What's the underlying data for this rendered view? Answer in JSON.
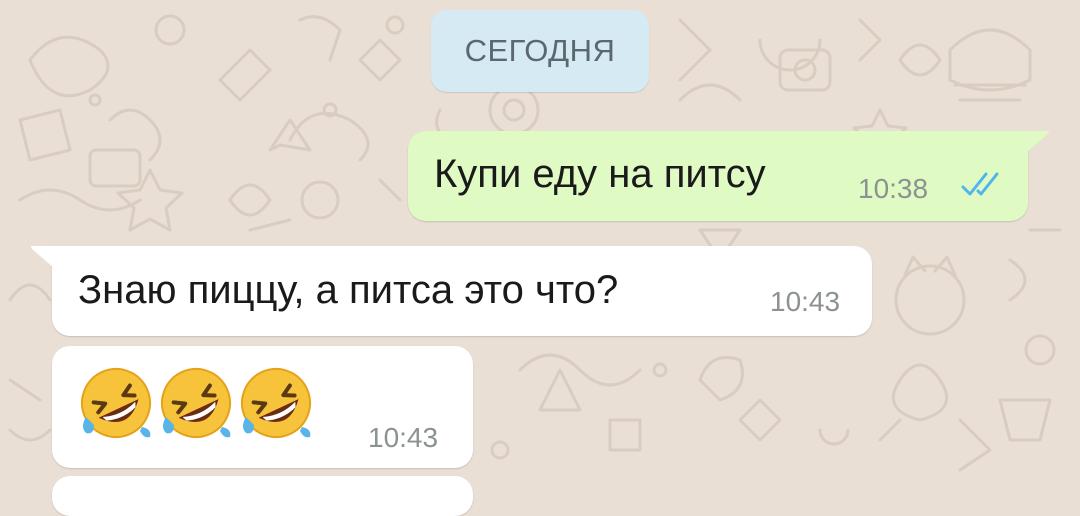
{
  "chat": {
    "date_label": "СЕГОДНЯ",
    "messages": [
      {
        "direction": "outgoing",
        "text": "Купи еду на питсу",
        "time": "10:38",
        "status_icon": "double-check-read-icon"
      },
      {
        "direction": "incoming",
        "text": "Знаю пиццу, а питса это что?",
        "time": "10:43"
      },
      {
        "direction": "incoming",
        "emojis": [
          "rolling-on-floor-laughing-emoji",
          "rolling-on-floor-laughing-emoji",
          "rolling-on-floor-laughing-emoji"
        ],
        "time": "10:43"
      }
    ]
  },
  "colors": {
    "wallpaper": "#e9dfd5",
    "outgoing_bubble": "#e0fac4",
    "incoming_bubble": "#ffffff",
    "date_chip": "#d5eaf3",
    "read_ticks": "#4fb6ec"
  }
}
